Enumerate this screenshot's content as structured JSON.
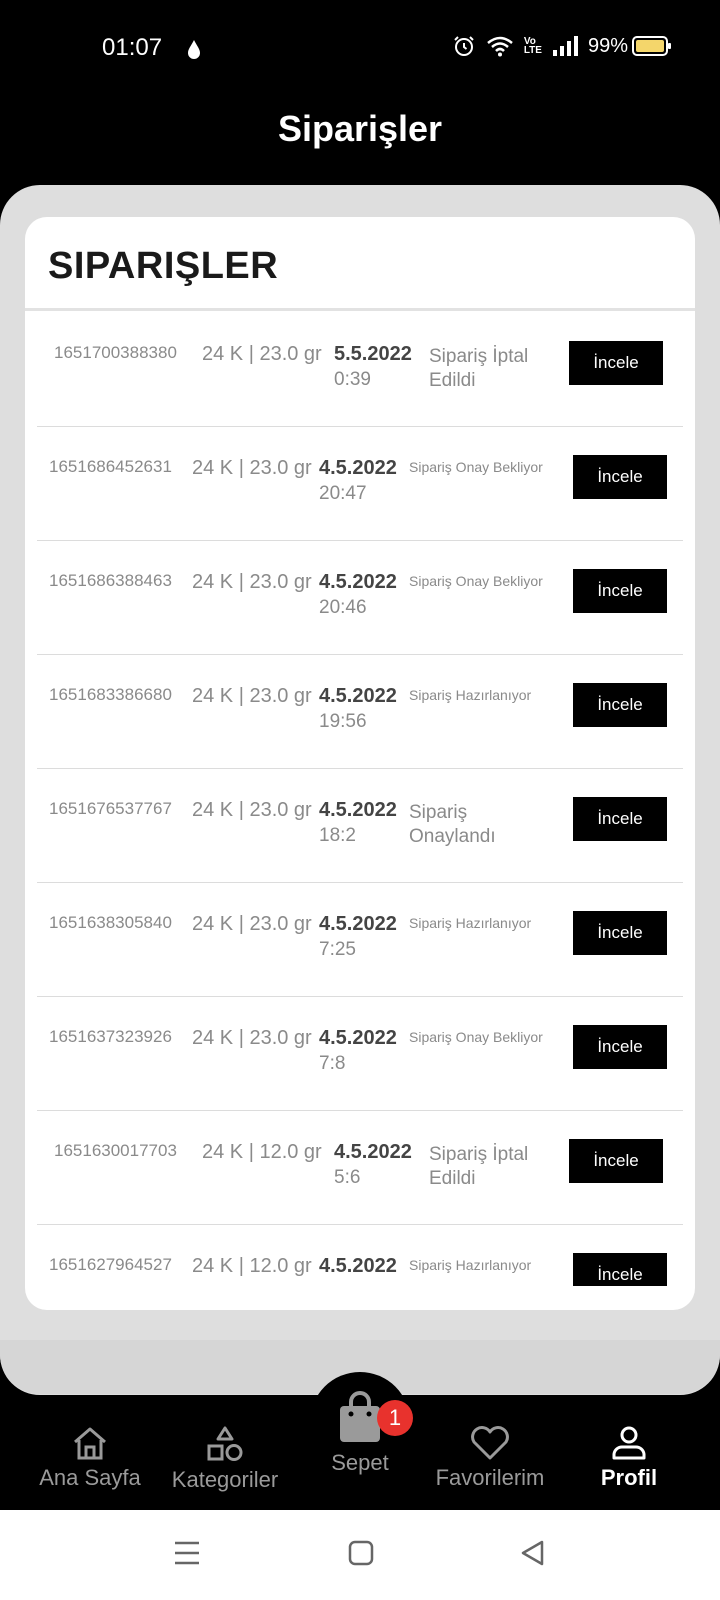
{
  "status_bar": {
    "time": "01:07",
    "battery": "99%",
    "icons": [
      "drop-icon",
      "alarm-icon",
      "wifi-icon",
      "volte-icon",
      "signal-icon",
      "battery-icon"
    ],
    "volte_label_top": "Vo",
    "volte_label_bottom": "LTE"
  },
  "header": {
    "title": "Siparişler"
  },
  "card": {
    "title": "SIPARIŞLER"
  },
  "orders": [
    {
      "id": "1651700388380",
      "karat": "24 K | 23.0 gr",
      "date": "5.5.2022",
      "time": "0:39",
      "status": "Sipariş İptal Edildi",
      "button": "İncele",
      "variant": "wide"
    },
    {
      "id": "1651686452631",
      "karat": "24 K | 23.0 gr",
      "date": "4.5.2022",
      "time": "20:47",
      "status": "Sipariş Onay Bekliyor",
      "button": "İncele",
      "variant": "narrow"
    },
    {
      "id": "1651686388463",
      "karat": "24 K | 23.0 gr",
      "date": "4.5.2022",
      "time": "20:46",
      "status": "Sipariş Onay Bekliyor",
      "button": "İncele",
      "variant": "narrow"
    },
    {
      "id": "1651683386680",
      "karat": "24 K | 23.0 gr",
      "date": "4.5.2022",
      "time": "19:56",
      "status": "Sipariş Hazırlanıyor",
      "button": "İncele",
      "variant": "narrow"
    },
    {
      "id": "1651676537767",
      "karat": "24 K | 23.0 gr",
      "date": "4.5.2022",
      "time": "18:2",
      "status": "Sipariş Onaylandı",
      "button": "İncele",
      "variant": "narrow-big"
    },
    {
      "id": "1651638305840",
      "karat": "24 K | 23.0 gr",
      "date": "4.5.2022",
      "time": "7:25",
      "status": "Sipariş Hazırlanıyor",
      "button": "İncele",
      "variant": "narrow"
    },
    {
      "id": "1651637323926",
      "karat": "24 K | 23.0 gr",
      "date": "4.5.2022",
      "time": "7:8",
      "status": "Sipariş Onay Bekliyor",
      "button": "İncele",
      "variant": "narrow"
    },
    {
      "id": "1651630017703",
      "karat": "24 K | 12.0 gr",
      "date": "4.5.2022",
      "time": "5:6",
      "status": "Sipariş İptal Edildi",
      "button": "İncele",
      "variant": "wide"
    },
    {
      "id": "1651627964527",
      "karat": "24 K | 12.0 gr",
      "date": "4.5.2022",
      "time": "",
      "status": "Sipariş Hazırlanıyor",
      "button": "İncele",
      "variant": "narrow"
    }
  ],
  "bottom_nav": {
    "items": [
      {
        "label": "Ana Sayfa",
        "icon": "home-icon"
      },
      {
        "label": "Kategoriler",
        "icon": "categories-icon"
      },
      {
        "label": "Sepet",
        "icon": "shopping-bag-icon",
        "badge": "1"
      },
      {
        "label": "Favorilerim",
        "icon": "heart-icon"
      },
      {
        "label": "Profil",
        "icon": "user-icon",
        "active": true
      }
    ]
  },
  "colors": {
    "background": "#000000",
    "panel": "#dedede",
    "badge": "#e8322d",
    "button": "#000000"
  }
}
